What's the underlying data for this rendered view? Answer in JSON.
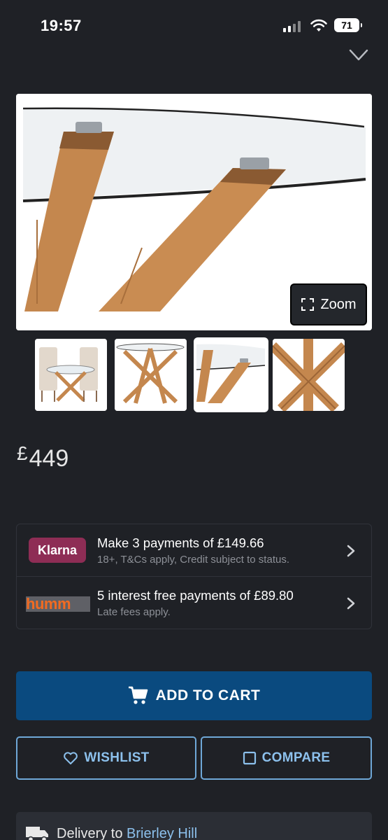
{
  "status_bar": {
    "time": "19:57",
    "battery": "71"
  },
  "product": {
    "image_zoom_label": "Zoom",
    "price_currency": "£",
    "price_value": "449"
  },
  "finance": {
    "klarna": {
      "badge": "Klarna",
      "title": "Make 3 payments of £149.66",
      "subtitle": "18+, T&Cs apply, Credit subject to status."
    },
    "humm": {
      "badge": "humm",
      "title": "5 interest free payments of £89.80",
      "subtitle": "Late fees apply."
    }
  },
  "actions": {
    "add_to_cart": "ADD TO CART",
    "wishlist": "WISHLIST",
    "compare": "COMPARE"
  },
  "delivery": {
    "prefix": "Delivery to ",
    "location": "Brierley Hill"
  },
  "colors": {
    "background": "#1f2126",
    "primary_button": "#0a4a7f",
    "outline_accent": "#6fa8d8",
    "klarna_pink": "#8e2d55",
    "humm_orange": "#f26b21"
  },
  "icons": [
    "heart-outline-icon",
    "fullscreen-icon",
    "chevron-right-icon",
    "cart-icon",
    "heart-icon",
    "checkbox-icon",
    "truck-icon"
  ]
}
